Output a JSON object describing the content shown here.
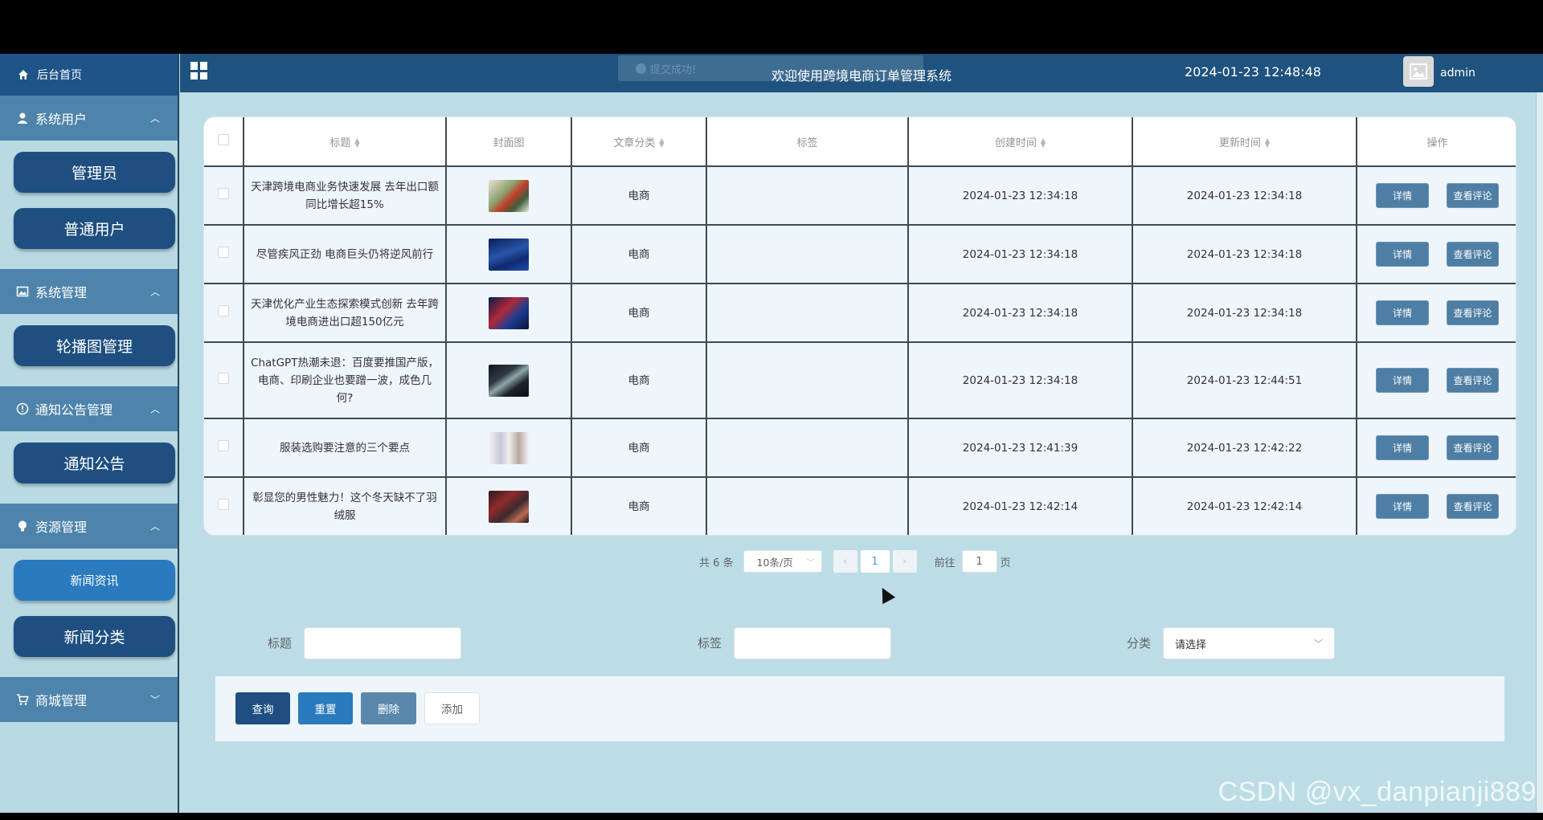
{
  "sidebar": {
    "home": "后台首页",
    "groups": [
      {
        "label": "系统用户",
        "items": [
          "管理员",
          "普通用户"
        ]
      },
      {
        "label": "系统管理",
        "items": [
          "轮播图管理"
        ]
      },
      {
        "label": "通知公告管理",
        "items": [
          "通知公告"
        ]
      },
      {
        "label": "资源管理",
        "items": [
          "新闻资讯",
          "新闻分类"
        ]
      },
      {
        "label": "商城管理",
        "items": []
      }
    ]
  },
  "header": {
    "toast": "提交成功!",
    "title": "欢迎使用跨境电商订单管理系统",
    "datetime": "2024-01-23 12:48:48",
    "user": "admin"
  },
  "table": {
    "columns": [
      "标题",
      "封面图",
      "文章分类",
      "标签",
      "创建时间",
      "更新时间",
      "操作"
    ],
    "detail_label": "详情",
    "review_label": "查看评论",
    "rows": [
      {
        "title": "天津跨境电商业务快速发展 去年出口额同比增长超15%",
        "category": "电商",
        "tag": "",
        "created": "2024-01-23 12:34:18",
        "updated": "2024-01-23 12:34:18"
      },
      {
        "title": "尽管疾风正劲 电商巨头仍将逆风前行",
        "category": "电商",
        "tag": "",
        "created": "2024-01-23 12:34:18",
        "updated": "2024-01-23 12:34:18"
      },
      {
        "title": "天津优化产业生态探索模式创新 去年跨境电商进出口超150亿元",
        "category": "电商",
        "tag": "",
        "created": "2024-01-23 12:34:18",
        "updated": "2024-01-23 12:34:18"
      },
      {
        "title": "ChatGPT热潮未退：百度要推国产版，电商、印刷企业也要蹭一波，成色几何?",
        "category": "电商",
        "tag": "",
        "created": "2024-01-23 12:34:18",
        "updated": "2024-01-23 12:44:51"
      },
      {
        "title": "服装选购要注意的三个要点",
        "category": "电商",
        "tag": "",
        "created": "2024-01-23 12:41:39",
        "updated": "2024-01-23 12:42:22"
      },
      {
        "title": "彰显您的男性魅力！这个冬天缺不了羽绒服",
        "category": "电商",
        "tag": "",
        "created": "2024-01-23 12:42:14",
        "updated": "2024-01-23 12:42:14"
      }
    ]
  },
  "pagination": {
    "total": "共 6 条",
    "page_size": "10条/页",
    "current_page": "1",
    "goto_prefix": "前往",
    "goto_value": "1",
    "goto_suffix": "页"
  },
  "search": {
    "title_label": "标题",
    "tag_label": "标签",
    "category_label": "分类",
    "category_placeholder": "请选择"
  },
  "actions": {
    "query": "查询",
    "reset": "重置",
    "delete": "删除",
    "add": "添加"
  },
  "watermark": "CSDN @vx_danpianji889",
  "colors": {
    "header_bg": "#1f527f",
    "sidebar_btn": "#1e4f80",
    "sidebar_group": "#4e84ab",
    "active_btn": "#2a7bbd",
    "page_bg": "#bcdde6"
  }
}
